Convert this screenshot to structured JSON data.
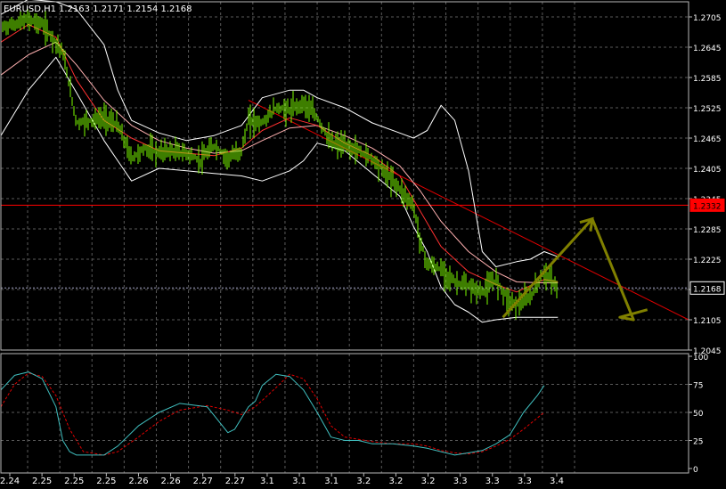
{
  "header": {
    "symbol": "EURUSD,H1",
    "ohlc": "1.2163 1.2171 1.2154 1.2168"
  },
  "colors": {
    "background": "#000000",
    "grid": "#5a5a5a",
    "frame": "#b8b8b8",
    "axis_text": "#ffffff",
    "candles": "#7cfc00",
    "bands": "#ffffff",
    "ma_fast": "#ff3030",
    "ma_slow": "#ffb0b0",
    "trendline": "#e00000",
    "resistance": "#ff0000",
    "bid_line": "#a0a0c0",
    "arrow": "#808000",
    "stoch_main": "#40c0c0",
    "stoch_signal": "#e00000"
  },
  "chart_data": [
    {
      "type": "line",
      "name_visible": "EURUSD,H1",
      "ylim": [
        1.2045,
        1.2735
      ],
      "y_ticks": [
        1.2705,
        1.2645,
        1.2585,
        1.2525,
        1.2465,
        1.2405,
        1.2345,
        1.2285,
        1.2225,
        1.2165,
        1.2105,
        1.2045
      ],
      "x_tick_labels": [
        "2.24",
        "2.25",
        "2.25",
        "2.25",
        "2.26",
        "2.26",
        "2.27",
        "2.27",
        "3.1",
        "3.1",
        "3.1",
        "3.2",
        "3.2",
        "3.2",
        "3.3",
        "3.3",
        "3.3",
        "3.4"
      ],
      "x_range": [
        0,
        100
      ],
      "price_labels": [
        {
          "text": "1.2332",
          "value": 1.2332,
          "style": "resistance"
        },
        {
          "text": "1.2168",
          "value": 1.2168,
          "style": "bid"
        }
      ],
      "price": {
        "x": [
          0,
          2,
          4,
          6,
          8,
          9,
          11,
          13,
          15,
          17,
          19,
          21,
          23,
          24,
          27,
          29,
          31,
          33,
          35,
          36,
          38,
          40,
          42,
          44,
          46,
          48,
          50,
          52,
          54,
          56,
          58,
          60,
          61,
          62,
          64,
          66,
          68,
          70,
          72,
          74,
          75,
          77,
          79,
          81
        ],
        "y": [
          1.2685,
          1.269,
          1.27,
          1.269,
          1.2655,
          1.2635,
          1.2495,
          1.25,
          1.2505,
          1.249,
          1.2425,
          1.2445,
          1.2435,
          1.244,
          1.2435,
          1.242,
          1.245,
          1.2425,
          1.244,
          1.25,
          1.2495,
          1.2525,
          1.252,
          1.2535,
          1.2505,
          1.2455,
          1.245,
          1.244,
          1.2425,
          1.2395,
          1.2365,
          1.233,
          1.226,
          1.2215,
          1.2205,
          1.218,
          1.217,
          1.216,
          1.2185,
          1.214,
          1.2135,
          1.215,
          1.22,
          1.2168
        ]
      },
      "ma_fast": {
        "x": [
          0,
          4,
          8,
          11,
          15,
          19,
          23,
          27,
          31,
          35,
          38,
          42,
          46,
          50,
          54,
          58,
          61,
          64,
          68,
          72,
          75,
          79,
          81
        ],
        "y": [
          1.2655,
          1.269,
          1.2665,
          1.258,
          1.25,
          1.2465,
          1.244,
          1.2435,
          1.243,
          1.2445,
          1.248,
          1.2505,
          1.249,
          1.2455,
          1.243,
          1.239,
          1.232,
          1.225,
          1.22,
          1.2175,
          1.216,
          1.2185,
          1.218
        ]
      },
      "ma_slow": {
        "x": [
          0,
          4,
          8,
          11,
          15,
          19,
          23,
          27,
          31,
          35,
          38,
          42,
          46,
          50,
          54,
          58,
          61,
          64,
          68,
          72,
          75,
          79,
          81
        ],
        "y": [
          1.259,
          1.263,
          1.2655,
          1.261,
          1.254,
          1.249,
          1.246,
          1.2445,
          1.2435,
          1.244,
          1.246,
          1.2485,
          1.249,
          1.247,
          1.2445,
          1.241,
          1.236,
          1.23,
          1.224,
          1.22,
          1.218,
          1.2178,
          1.2178
        ]
      },
      "band_upper": {
        "x": [
          0,
          4,
          8,
          11,
          15,
          17,
          19,
          23,
          27,
          31,
          35,
          38,
          42,
          44,
          46,
          50,
          54,
          58,
          60,
          62,
          64,
          66,
          68,
          70,
          72,
          75,
          77,
          79,
          81
        ],
        "y": [
          1.271,
          1.274,
          1.2735,
          1.272,
          1.265,
          1.256,
          1.25,
          1.2475,
          1.246,
          1.247,
          1.249,
          1.2545,
          1.256,
          1.256,
          1.2545,
          1.2525,
          1.2495,
          1.2475,
          1.2465,
          1.248,
          1.253,
          1.25,
          1.24,
          1.224,
          1.221,
          1.222,
          1.2225,
          1.224,
          1.223
        ]
      },
      "band_lower": {
        "x": [
          0,
          4,
          8,
          11,
          15,
          17,
          19,
          23,
          27,
          31,
          35,
          38,
          42,
          44,
          46,
          50,
          54,
          58,
          60,
          62,
          64,
          66,
          68,
          70,
          72,
          75,
          77,
          79,
          81
        ],
        "y": [
          1.247,
          1.256,
          1.2625,
          1.2555,
          1.246,
          1.242,
          1.238,
          1.2405,
          1.24,
          1.2395,
          1.239,
          1.238,
          1.24,
          1.242,
          1.2455,
          1.244,
          1.2395,
          1.235,
          1.229,
          1.224,
          1.217,
          1.2135,
          1.212,
          1.21,
          1.2105,
          1.211,
          1.211,
          1.211,
          1.211
        ]
      },
      "trendline": {
        "x": [
          36,
          100
        ],
        "y": [
          1.254,
          1.2105
        ]
      },
      "resistance_level": 1.2332,
      "bid_level": 1.2168,
      "forecast_path": {
        "x": [
          73,
          86,
          92,
          90,
          94
        ],
        "y": [
          1.211,
          1.2305,
          1.2105,
          1.211,
          1.2125
        ]
      }
    },
    {
      "type": "line",
      "ylim": [
        0,
        100
      ],
      "y_ticks": [
        100,
        75,
        50,
        25,
        0
      ],
      "x_range": [
        0,
        100
      ],
      "stoch_main": {
        "x": [
          0,
          2,
          4,
          6,
          8,
          9,
          10,
          11,
          12,
          15,
          17,
          20,
          23,
          26,
          30,
          33,
          34,
          35,
          36,
          37,
          38,
          40,
          42,
          44,
          46,
          48,
          50,
          52,
          54,
          57,
          60,
          62,
          64,
          66,
          68,
          70,
          72,
          74,
          76,
          78,
          79
        ],
        "y": [
          70,
          83,
          86,
          80,
          55,
          25,
          15,
          12,
          12,
          12,
          20,
          38,
          50,
          58,
          55,
          32,
          35,
          45,
          55,
          60,
          74,
          84,
          82,
          70,
          50,
          28,
          25,
          25,
          22,
          22,
          20,
          18,
          15,
          12,
          14,
          16,
          22,
          30,
          50,
          65,
          74
        ]
      },
      "stoch_signal": {
        "x": [
          0,
          2,
          4,
          6,
          8,
          10,
          12,
          15,
          17,
          20,
          23,
          26,
          30,
          33,
          35,
          37,
          40,
          42,
          44,
          46,
          48,
          50,
          52,
          54,
          57,
          60,
          62,
          64,
          66,
          68,
          70,
          72,
          74,
          76,
          78,
          79
        ],
        "y": [
          55,
          75,
          85,
          82,
          65,
          35,
          15,
          12,
          15,
          28,
          42,
          52,
          56,
          52,
          48,
          55,
          72,
          84,
          80,
          62,
          38,
          28,
          26,
          24,
          22,
          22,
          20,
          16,
          14,
          13,
          15,
          20,
          26,
          35,
          45,
          50
        ]
      }
    }
  ]
}
